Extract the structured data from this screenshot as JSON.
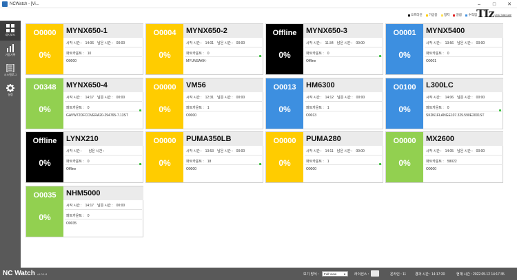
{
  "window": {
    "title": "NCWatch - [Vi..."
  },
  "legend": [
    {
      "label": "오프라인",
      "color": "#000000"
    },
    {
      "label": "가공중",
      "color": "#ffcc00"
    },
    {
      "label": "정지",
      "color": "#ffe14d"
    },
    {
      "label": "알람",
      "color": "#e02020"
    },
    {
      "label": "수작업",
      "color": "#3d8fe0"
    }
  ],
  "logo": {
    "mark": "TIz",
    "subtitle": "CNC Total Care"
  },
  "sidebar": [
    {
      "label": "대시보드",
      "icon": "dashboard-icon"
    },
    {
      "label": "가동기록",
      "icon": "chart-icon"
    },
    {
      "label": "시스템로그",
      "icon": "log-icon"
    },
    {
      "label": "설정",
      "icon": "gear-icon"
    }
  ],
  "labels": {
    "start": "시작 시간 :",
    "remain": "남은 시간 :",
    "parts": "파트카운트 :"
  },
  "cards": [
    {
      "code": "O0000",
      "pct": "0%",
      "name": "MYNX650-1",
      "start": "14:06",
      "remain": "00:00",
      "parts": "10",
      "program": "O0000",
      "color": "#ffcc00",
      "dot": false
    },
    {
      "code": "O0004",
      "pct": "0%",
      "name": "MYNX650-2",
      "start": "14:01",
      "remain": "00:00",
      "parts": "0",
      "program": "MYUNSAKK-",
      "color": "#ffcc00",
      "dot": true
    },
    {
      "code": "Offline",
      "pct": "0%",
      "name": "MYNX650-3",
      "start": "11:34",
      "remain": "00:00",
      "parts": "0",
      "program": "Offline",
      "color": "#000000",
      "dot": true
    },
    {
      "code": "O0001",
      "pct": "0%",
      "name": "MYNX5400",
      "start": "13:56",
      "remain": "00:00",
      "parts": "0",
      "program": "O0001",
      "color": "#3d8fe0",
      "dot": false
    },
    {
      "code": "O0348",
      "pct": "0%",
      "name": "MYNX650-4",
      "start": "14:17",
      "remain": "00:00",
      "parts": "0",
      "program": "GAVW72DFCOVERA20-294765-7.13ST",
      "color": "#92d050",
      "dot": true
    },
    {
      "code": "O0000",
      "pct": "0%",
      "name": "VM56",
      "start": "12:31",
      "remain": "00:00",
      "parts": "1",
      "program": "O0000",
      "color": "#ffcc00",
      "dot": false
    },
    {
      "code": "O0013",
      "pct": "0%",
      "name": "HM6300",
      "start": "14:12",
      "remain": "00:00",
      "parts": "1",
      "program": "O0013",
      "color": "#3d8fe0",
      "dot": false
    },
    {
      "code": "O0100",
      "pct": "0%",
      "name": "L300LC",
      "start": "14:06",
      "remain": "00:00",
      "parts": "0",
      "program": "SKD61FLANGE107.329.590E2001ST",
      "color": "#3d8fe0",
      "dot": true
    },
    {
      "code": "Offline",
      "pct": "0%",
      "name": "LYNX210",
      "start": "",
      "remain": "",
      "parts": "0",
      "program": "Offline",
      "color": "#000000",
      "dot": true
    },
    {
      "code": "O0000",
      "pct": "0%",
      "name": "PUMA350LB",
      "start": "13:53",
      "remain": "00:00",
      "parts": "18",
      "program": "O0000",
      "color": "#ffcc00",
      "dot": true
    },
    {
      "code": "O0000",
      "pct": "0%",
      "name": "PUMA280",
      "start": "14:11",
      "remain": "00:00",
      "parts": "1",
      "program": "O0000",
      "color": "#ffcc00",
      "dot": true
    },
    {
      "code": "O0000",
      "pct": "0%",
      "name": "MX2600",
      "start": "14:05",
      "remain": "00:00",
      "parts": "58022",
      "program": "O0000",
      "color": "#92d050",
      "dot": false
    },
    {
      "code": "O0035",
      "pct": "0%",
      "name": "NHM5000",
      "start": "14:17",
      "remain": "00:00",
      "parts": "0",
      "program": "O0035",
      "color": "#92d050",
      "dot": false
    }
  ],
  "bottom": {
    "brand": "NC Watch",
    "version": "v1.0.1.8",
    "view_label": "보기 방식 :",
    "view_value": "Full View",
    "license_label": "라이선스 :",
    "online": "온라인 : 11",
    "elapsed": "경과 시간 : 14:17:20",
    "now": "현재 시간 : 2022.05.12 14:17:35"
  }
}
